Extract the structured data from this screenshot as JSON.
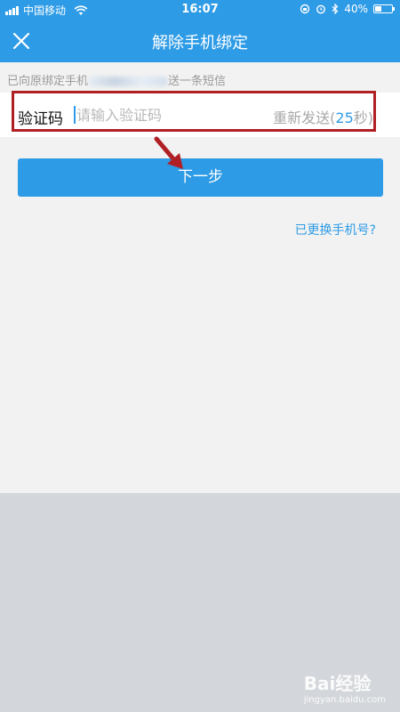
{
  "status_bar": {
    "carrier": "中国移动",
    "time": "16:07",
    "battery": "40%",
    "battery_level": 0.4
  },
  "nav": {
    "title": "解除手机绑定",
    "close_icon": "close-icon"
  },
  "hint": {
    "prefix": "已向原绑定手机",
    "suffix": "送一条短信"
  },
  "code_field": {
    "label": "验证码",
    "placeholder": "请输入验证码",
    "resend_prefix": "重新发送(",
    "resend_count": "25",
    "resend_suffix": "秒)"
  },
  "next_button": {
    "label": "下一步"
  },
  "links": {
    "changed_phone": "已更换手机号?"
  },
  "watermark": {
    "brand": "Bai",
    "brand2": "经验",
    "url": "jingyan.baidu.com"
  },
  "colors": {
    "primary": "#2e9be6",
    "highlight": "#b01f24"
  }
}
